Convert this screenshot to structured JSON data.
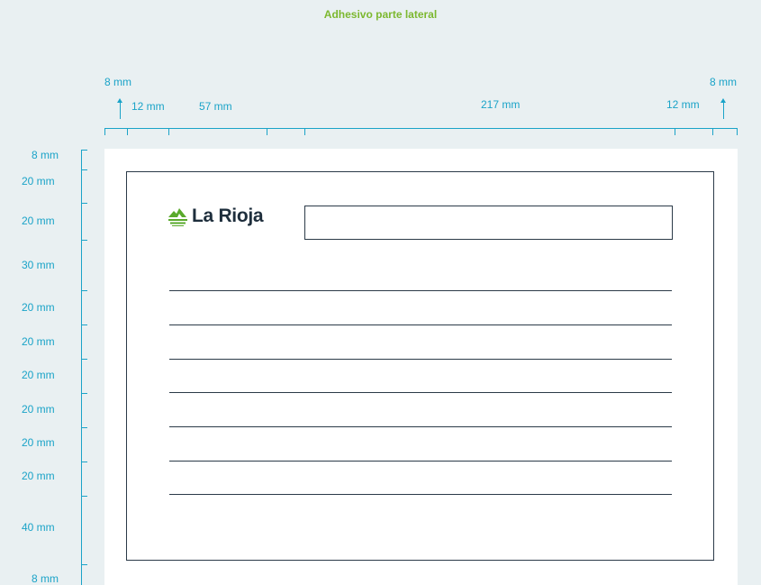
{
  "title": "Adhesivo parte lateral",
  "logo": {
    "text": "La Rioja",
    "icon": "la-rioja-mountain-icon",
    "color": "#5aaa2c"
  },
  "horizontal_dims": {
    "left_margin": "8 mm",
    "right_margin": "8 mm",
    "inner_left": "12 mm",
    "logo_width": "57 mm",
    "field_width": "217 mm",
    "inner_right": "12 mm"
  },
  "vertical_dims": [
    "8 mm",
    "20 mm",
    "20 mm",
    "30 mm",
    "20 mm",
    "20 mm",
    "20 mm",
    "20 mm",
    "20 mm",
    "20 mm",
    "40 mm",
    "8 mm"
  ],
  "writing_lines": 7,
  "colors": {
    "dimension": "#1aa3c8",
    "title": "#7cb82f",
    "ink": "#2b3a48",
    "background": "#e9f0f2"
  }
}
